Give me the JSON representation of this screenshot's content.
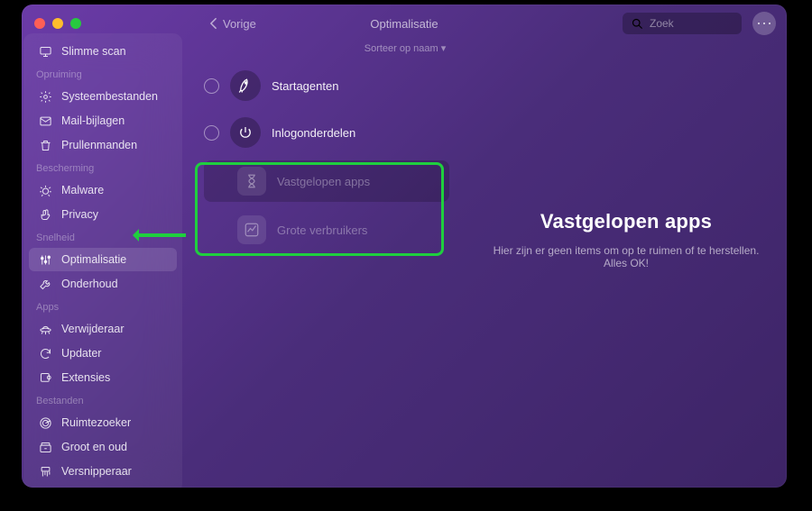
{
  "topbar": {
    "back_label": "Vorige",
    "title": "Optimalisatie",
    "search_placeholder": "Zoek"
  },
  "sidebar": {
    "smart_scan": "Slimme scan",
    "sections": {
      "cleanup": {
        "label": "Opruiming",
        "items": [
          "Systeembestanden",
          "Mail-bijlagen",
          "Prullenmanden"
        ]
      },
      "protection": {
        "label": "Bescherming",
        "items": [
          "Malware",
          "Privacy"
        ]
      },
      "speed": {
        "label": "Snelheid",
        "items": [
          "Optimalisatie",
          "Onderhoud"
        ],
        "active_index": 0
      },
      "apps": {
        "label": "Apps",
        "items": [
          "Verwijderaar",
          "Updater",
          "Extensies"
        ]
      },
      "files": {
        "label": "Bestanden",
        "items": [
          "Ruimtezoeker",
          "Groot en oud",
          "Versnipperaar"
        ]
      }
    }
  },
  "content": {
    "sort_label": "Sorteer op naam",
    "categories": [
      {
        "label": "Startagenten",
        "icon": "rocket",
        "selectable": true,
        "dim": false
      },
      {
        "label": "Inlogonderdelen",
        "icon": "power",
        "selectable": true,
        "dim": false
      },
      {
        "label": "Vastgelopen apps",
        "icon": "hourglass",
        "selectable": false,
        "dim": true
      },
      {
        "label": "Grote verbruikers",
        "icon": "chart",
        "selectable": false,
        "dim": true
      }
    ]
  },
  "detail": {
    "title": "Vastgelopen apps",
    "subtitle": "Hier zijn er geen items om op te ruimen of te herstellen. Alles OK!"
  }
}
